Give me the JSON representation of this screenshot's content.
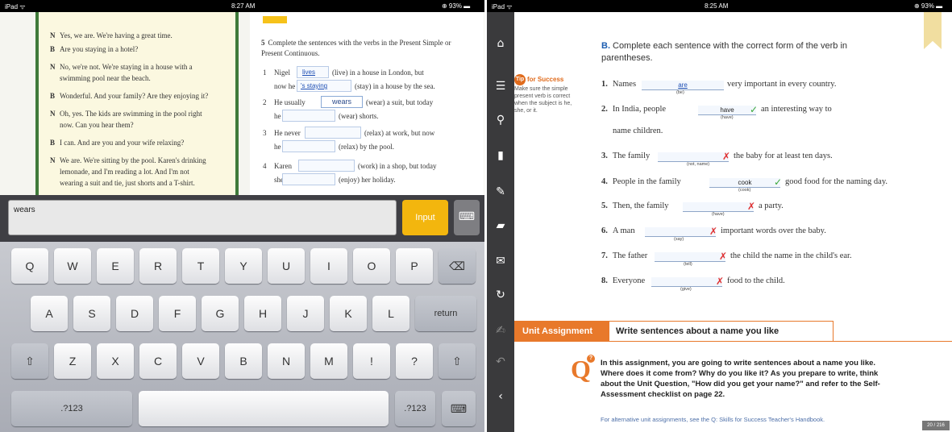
{
  "left_device": {
    "status": {
      "carrier": "iPad ᯤ",
      "time": "8:27 AM",
      "battery": "⊕ 93% ▬"
    },
    "dialogue": [
      {
        "speaker": "N",
        "text": "Yes, we are. We're having a great time."
      },
      {
        "speaker": "B",
        "text": "Are you staying in a hotel?"
      },
      {
        "speaker": "N",
        "text": "No, we're not. We're staying in a house with a"
      },
      {
        "speaker": "",
        "text": "swimming pool near the beach."
      },
      {
        "speaker": "B",
        "text": "Wonderful. And your family? Are they enjoying it?"
      },
      {
        "speaker": "N",
        "text": "Oh, yes. The kids are swimming in the pool right"
      },
      {
        "speaker": "",
        "text": "now. Can you hear them?"
      },
      {
        "speaker": "B",
        "text": "I can. And are you and your wife relaxing?"
      },
      {
        "speaker": "N",
        "text": "We are. We're sitting by the pool. Karen's drinking"
      },
      {
        "speaker": "",
        "text": "lemonade, and I'm reading a lot. And I'm not"
      },
      {
        "speaker": "",
        "text": "wearing a suit and tie, just shorts and a T-shirt."
      }
    ],
    "exercise": {
      "number": "5",
      "instruction": "Complete the sentences with the verbs in the Present Simple or Present Continuous.",
      "items": [
        {
          "num": "1",
          "a": "Nigel",
          "fill1": "lives",
          "b": "(live) in a house in London, but",
          "c": "now he",
          "fill2": "'s staying",
          "d": "(stay) in a house by the sea."
        },
        {
          "num": "2",
          "a": "He usually",
          "fill1": "wears",
          "b": "(wear) a suit, but today",
          "c": "he",
          "d": "(wear) shorts."
        },
        {
          "num": "3",
          "a": "He never",
          "b": "(relax) at work, but now",
          "c": "he",
          "d": "(relax) by the pool."
        },
        {
          "num": "4",
          "a": "Karen",
          "b": "(work) in a shop, but today",
          "c": "she",
          "d": "(enjoy) her holiday."
        }
      ]
    },
    "input": {
      "value": "wears",
      "button": "Input",
      "hide_icon": "⌨"
    },
    "keyboard": {
      "row1": [
        "Q",
        "W",
        "E",
        "R",
        "T",
        "Y",
        "U",
        "I",
        "O",
        "P"
      ],
      "backspace": "⌫",
      "row2": [
        "A",
        "S",
        "D",
        "F",
        "G",
        "H",
        "J",
        "K",
        "L"
      ],
      "return": "return",
      "shift": "⇧",
      "row3": [
        "Z",
        "X",
        "C",
        "V",
        "B",
        "N",
        "M",
        "!",
        ",",
        "?",
        "."
      ],
      "numbers": ".?123",
      "hide": "⌨"
    }
  },
  "right_device": {
    "status": {
      "carrier": "iPad ᯤ",
      "time": "8:25 AM",
      "battery": "⊕ 93% ▬"
    },
    "toolbar": [
      "home-icon",
      "list-icon",
      "search-icon",
      "book-icon",
      "pen-icon",
      "note-icon",
      "mail-icon",
      "sync-icon",
      "edit-icon",
      "undo-icon",
      "back-icon"
    ],
    "toolbar_glyphs": [
      "⌂",
      "☰",
      "⚲",
      "▮",
      "✎",
      "▰",
      "✉",
      "↻",
      "✍",
      "↶",
      "‹"
    ],
    "tip": {
      "badge": "Tip",
      "title": "for Success",
      "text": "Make sure the simple present verb is correct when the subject is he, she, or it."
    },
    "heading": {
      "letter": "B.",
      "text": "Complete each sentence with the correct form of the verb in parentheses."
    },
    "sentences": [
      {
        "n": "1.",
        "before": "Names",
        "answer": "are",
        "hint": "(be)",
        "after": "very important in every country.",
        "mark": ""
      },
      {
        "n": "2.",
        "before": "In India, people",
        "answer": "have",
        "hint": "(have)",
        "after": "an interesting way to",
        "after2": "name children.",
        "mark": "✓"
      },
      {
        "n": "3.",
        "before": "The family",
        "answer": "",
        "hint": "(not, name)",
        "after": "the baby for at least ten days.",
        "mark": "✗"
      },
      {
        "n": "4.",
        "before": "People in the family",
        "answer": "cook",
        "hint": "(cook)",
        "after": "good food for the naming day.",
        "mark": "✓"
      },
      {
        "n": "5.",
        "before": "Then, the family",
        "answer": "",
        "hint": "(have)",
        "after": "a party.",
        "mark": "✗"
      },
      {
        "n": "6.",
        "before": "A man",
        "answer": "",
        "hint": "(say)",
        "after": "important words over the baby.",
        "mark": "✗"
      },
      {
        "n": "7.",
        "before": "The father",
        "answer": "",
        "hint": "(tell)",
        "after": "the child the name in the child's ear.",
        "mark": "✗"
      },
      {
        "n": "8.",
        "before": "Everyone",
        "answer": "",
        "hint": "(give)",
        "after": "food to the child.",
        "mark": "✗"
      }
    ],
    "unit": {
      "label": "Unit Assignment",
      "title": "Write sentences about a name you like"
    },
    "assignment": {
      "q": "Q",
      "text": "In this assignment, you are going to write sentences about a name you like. Where does it come from? Why do you like it? As you prepare to write, think about the Unit Question, \"How did you get your name?\" and refer to the Self-Assessment checklist on page 22.",
      "footnote": "For alternative unit assignments, see the Q: Skills for Success Teacher's Handbook."
    },
    "page": "20 / 216"
  }
}
